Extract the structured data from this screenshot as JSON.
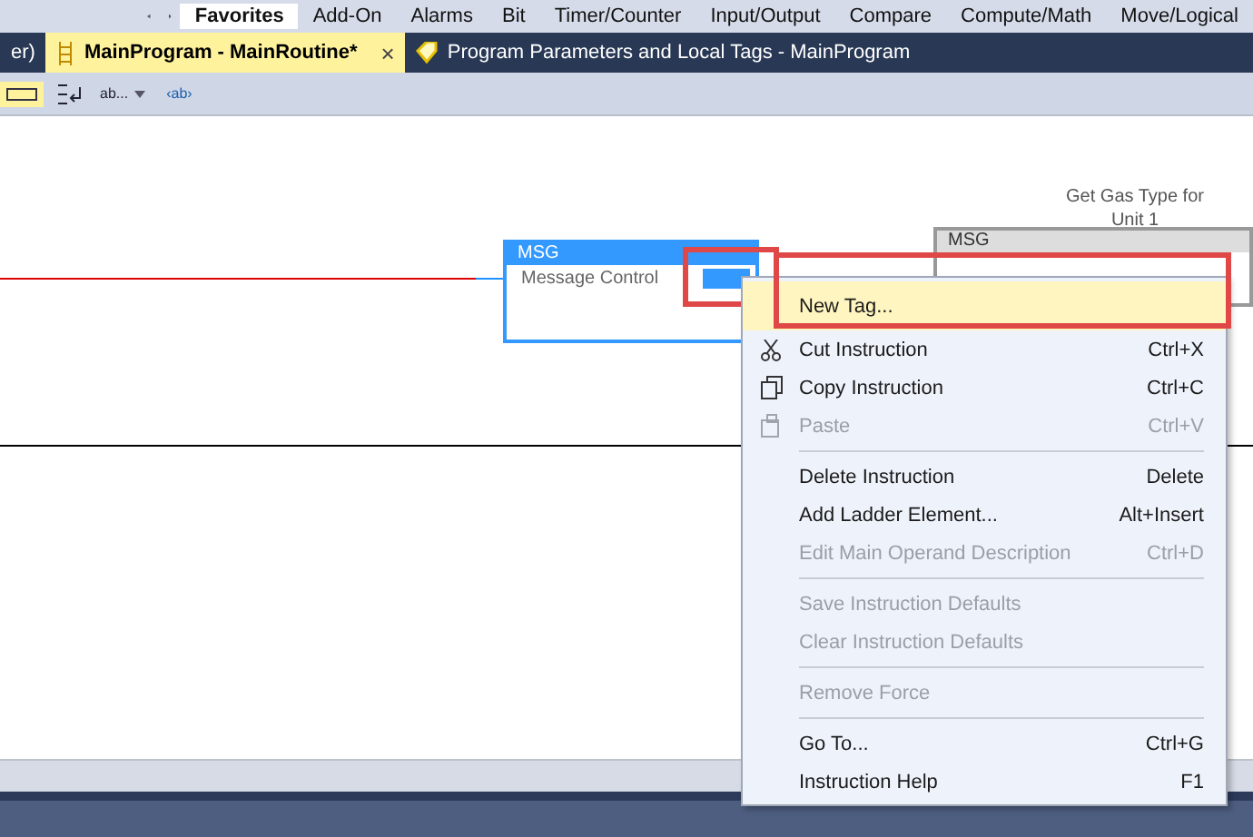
{
  "instruction_tabs": [
    {
      "label": "Favorites",
      "selected": true
    },
    {
      "label": "Add-On",
      "selected": false
    },
    {
      "label": "Alarms",
      "selected": false
    },
    {
      "label": "Bit",
      "selected": false
    },
    {
      "label": "Timer/Counter",
      "selected": false
    },
    {
      "label": "Input/Output",
      "selected": false
    },
    {
      "label": "Compare",
      "selected": false
    },
    {
      "label": "Compute/Math",
      "selected": false
    },
    {
      "label": "Move/Logical",
      "selected": false
    }
  ],
  "document_tabs": [
    {
      "label": "er)",
      "selected": false
    },
    {
      "label": "MainProgram - MainRoutine*",
      "selected": true,
      "close": "×"
    },
    {
      "label": "Program Parameters and Local Tags - MainProgram",
      "selected": false
    }
  ],
  "toolbar": {
    "dropdown": "ab...",
    "tag_button": "‹ab›"
  },
  "rung": {
    "instruction": {
      "name": "MSG",
      "operand_label": "Message Control"
    },
    "description": "Get Gas Type for Unit 1",
    "next_instruction": {
      "name": "MSG"
    }
  },
  "context_menu": [
    {
      "kind": "item",
      "label": "New Tag...",
      "disabled": false,
      "selected": true
    },
    {
      "kind": "item",
      "label": "Cut Instruction",
      "shortcut": "Ctrl+X",
      "disabled": false,
      "selected": false
    },
    {
      "kind": "item",
      "label": "Copy Instruction",
      "shortcut": "Ctrl+C",
      "disabled": false,
      "selected": false
    },
    {
      "kind": "item",
      "label": "Paste",
      "shortcut": "Ctrl+V",
      "disabled": true,
      "selected": false
    },
    {
      "kind": "separator"
    },
    {
      "kind": "item",
      "label": "Delete Instruction",
      "shortcut": "Delete",
      "disabled": false,
      "selected": false
    },
    {
      "kind": "item",
      "label": "Add Ladder Element...",
      "shortcut": "Alt+Insert",
      "disabled": false,
      "selected": false
    },
    {
      "kind": "item",
      "label": "Edit Main Operand Description",
      "shortcut": "Ctrl+D",
      "disabled": true,
      "selected": false
    },
    {
      "kind": "separator"
    },
    {
      "kind": "item",
      "label": "Save Instruction Defaults",
      "disabled": true,
      "selected": false
    },
    {
      "kind": "item",
      "label": "Clear Instruction Defaults",
      "disabled": true,
      "selected": false
    },
    {
      "kind": "separator"
    },
    {
      "kind": "item",
      "label": "Remove Force",
      "disabled": true,
      "selected": false
    },
    {
      "kind": "separator"
    },
    {
      "kind": "item",
      "label": "Go To...",
      "shortcut": "Ctrl+G",
      "disabled": false,
      "selected": false
    },
    {
      "kind": "item",
      "label": "Instruction Help",
      "shortcut": "F1",
      "disabled": false,
      "selected": false
    }
  ]
}
